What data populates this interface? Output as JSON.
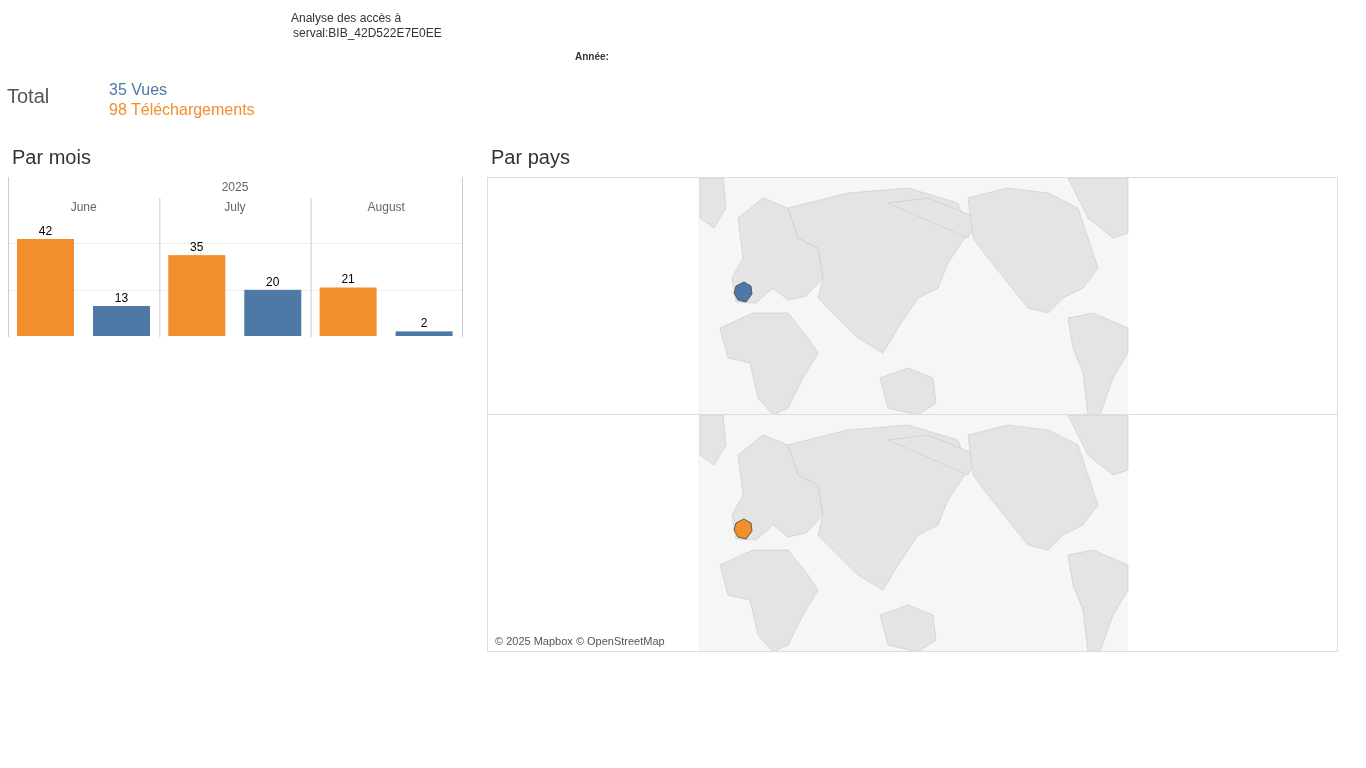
{
  "header": {
    "title_line_1": "Analyse des accès à",
    "title_line_2": "serval:BIB_42D522E7E0EE",
    "year_filter_label": "Année:"
  },
  "totals": {
    "label": "Total",
    "items": [
      {
        "text": "35 Vues",
        "color": "#4e79a7"
      },
      {
        "text": "98 Téléchargements",
        "color": "#f28e2b"
      }
    ]
  },
  "by_month": {
    "title": "Par mois",
    "year_header": "2025",
    "chart_data": {
      "type": "bar",
      "categories": [
        "June",
        "July",
        "August"
      ],
      "series": [
        {
          "color": "#f28e2b",
          "values": [
            42,
            35,
            21
          ]
        },
        {
          "color": "#4e79a7",
          "values": [
            13,
            20,
            2
          ]
        }
      ],
      "data_labels": true
    }
  },
  "by_country": {
    "title": "Par pays",
    "panels": [
      {
        "color": "#4e79a7"
      },
      {
        "color": "#f28e2b"
      }
    ],
    "attribution": "© 2025 Mapbox © OpenStreetMap"
  }
}
